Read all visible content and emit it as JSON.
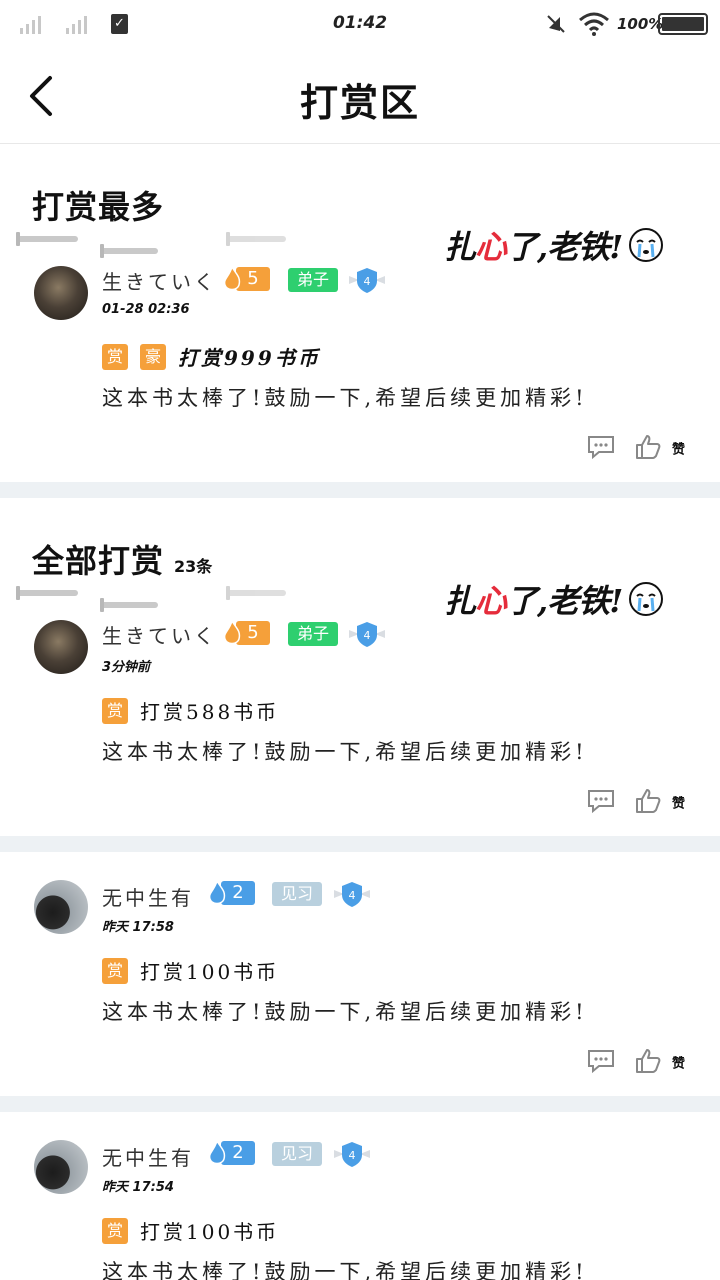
{
  "status_bar": {
    "time": "01:42",
    "battery": "100%"
  },
  "header": {
    "title": "打赏区",
    "back_icon": "chevron-left-icon"
  },
  "sections": {
    "top": {
      "title": "打赏最多"
    },
    "all": {
      "title": "全部打赏",
      "count": "23条"
    }
  },
  "sticker": {
    "text_part1": "扎",
    "text_heart": "心",
    "text_part2": "了,老铁",
    "text_mark": "!"
  },
  "comments": [
    {
      "user": "生きていく",
      "level": "5",
      "badge": "弟子",
      "rank": "4",
      "time": "01-28 02:36",
      "tags": [
        "赏",
        "豪"
      ],
      "reward": "打赏999书币",
      "message": "这本书太棒了!鼓励一下,希望后续更加精彩!",
      "like_label": "赞"
    },
    {
      "user": "生きていく",
      "level": "5",
      "badge": "弟子",
      "rank": "4",
      "time": "3分钟前",
      "tags": [
        "赏"
      ],
      "reward": "打赏588书币",
      "message": "这本书太棒了!鼓励一下,希望后续更加精彩!",
      "like_label": "赞"
    },
    {
      "user": "无中生有",
      "level": "2",
      "badge": "见习",
      "rank": "4",
      "time": "昨天 17:58",
      "tags": [
        "赏"
      ],
      "reward": "打赏100书币",
      "message": "这本书太棒了!鼓励一下,希望后续更加精彩!",
      "like_label": "赞"
    },
    {
      "user": "无中生有",
      "level": "2",
      "badge": "见习",
      "rank": "4",
      "time": "昨天 17:54",
      "tags": [
        "赏"
      ],
      "reward": "打赏100书币",
      "message": "这本书太棒了!鼓励一下,希望后续更加精彩!",
      "like_label": "赞"
    }
  ],
  "colors": {
    "accent_orange": "#f5a03a",
    "badge_green": "#2ecf6f",
    "level_blue": "#4a9ee6",
    "divider": "#edf1f4"
  }
}
